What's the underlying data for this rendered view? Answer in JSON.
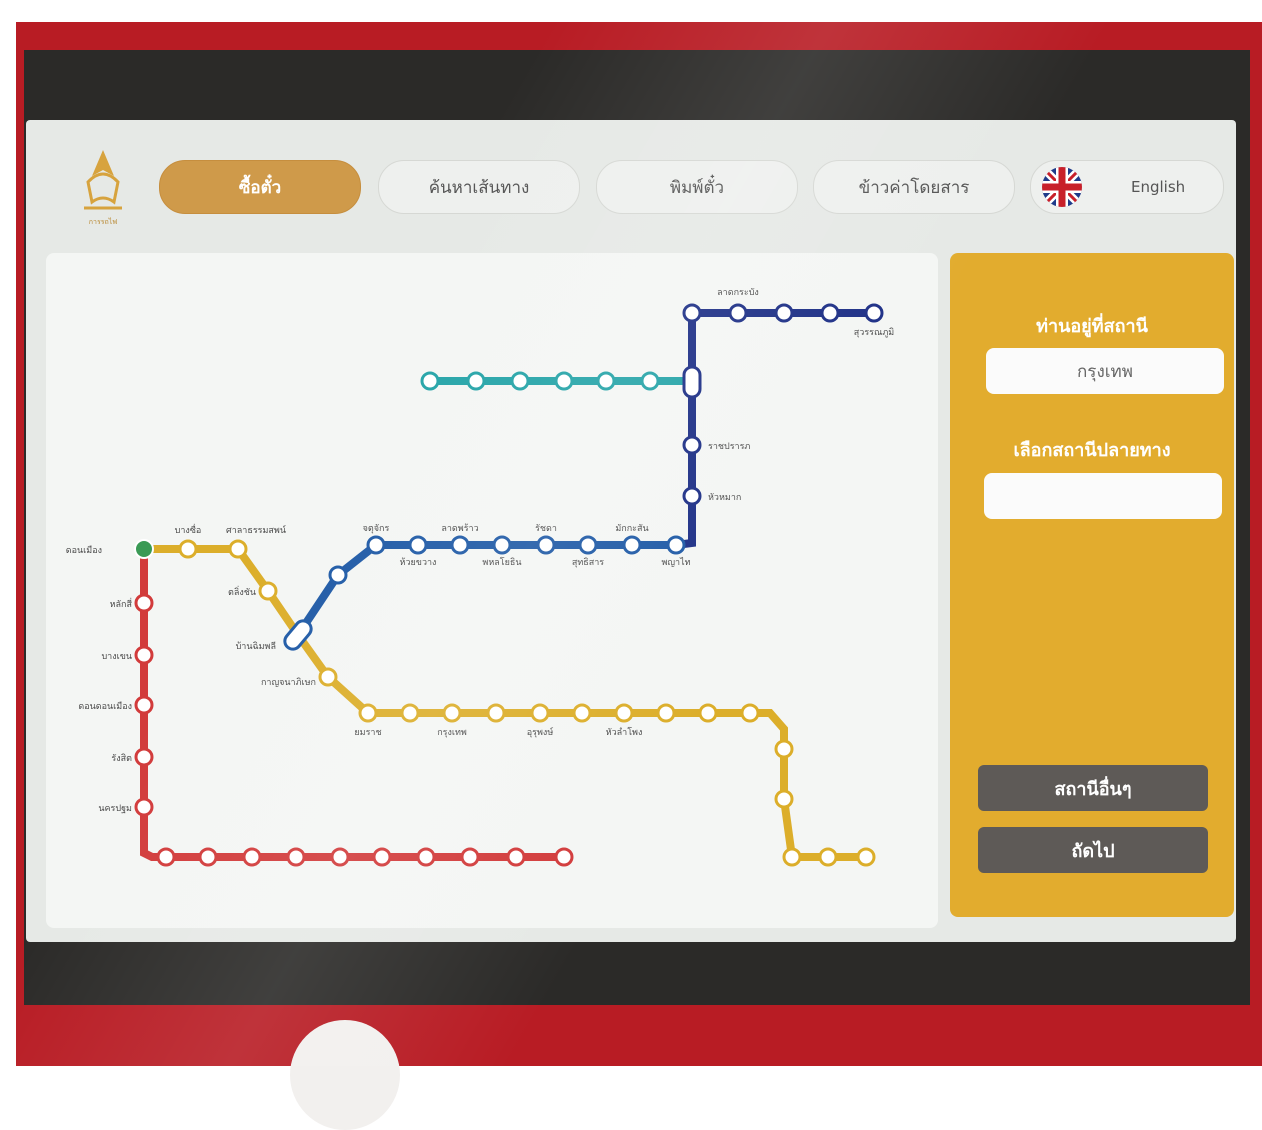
{
  "header": {
    "logo_text": "การรถไฟ",
    "tabs": [
      {
        "label": "ซื้อตั๋ว",
        "active": true
      },
      {
        "label": "ค้นหาเส้นทาง",
        "active": false
      },
      {
        "label": "พิมพ์ตั๋ว",
        "active": false
      },
      {
        "label": "ข้าวค่าโดยสาร",
        "active": false
      }
    ],
    "language_label": "English",
    "language_icon": "uk-flag-icon"
  },
  "side_panel": {
    "current_station_title": "ท่านอยู่ที่สถานี",
    "current_station_value": "กรุงเทพ",
    "destination_title": "เลือกสถานีปลายทาง",
    "destination_placeholder": "",
    "other_stations_button": "สถานีอื่นๆ",
    "next_button": "ถัดไป"
  },
  "map": {
    "colors": {
      "red": "#d23b3b",
      "gold": "#dcae2a",
      "blue": "#1f5aa6",
      "navy": "#1d2f86",
      "teal": "#25a4a8"
    },
    "labels": [
      "ดอนเมือง",
      "หลักสี่",
      "บางเขน",
      "ดอนดอนเมือง",
      "รังสิต",
      "นครปฐม",
      "บางซื่อ",
      "ศาลาธรรมสพน์",
      "ตลิ่งชัน",
      "บ้านฉิมพลี",
      "กาญจนาภิเษก",
      "จตุจักร",
      "ห้วยขวาง",
      "ลาดพร้าว",
      "พหลโยธิน",
      "รัชดา",
      "สุทธิสาร",
      "มักกะสัน",
      "พญาไท",
      "ราชปรารภ",
      "หัวหมาก",
      "ลาดกระบัง",
      "สุวรรณภูมิ",
      "ยมราช",
      "กรุงเทพ",
      "อุรุพงษ์",
      "หัวลำโพง"
    ]
  }
}
